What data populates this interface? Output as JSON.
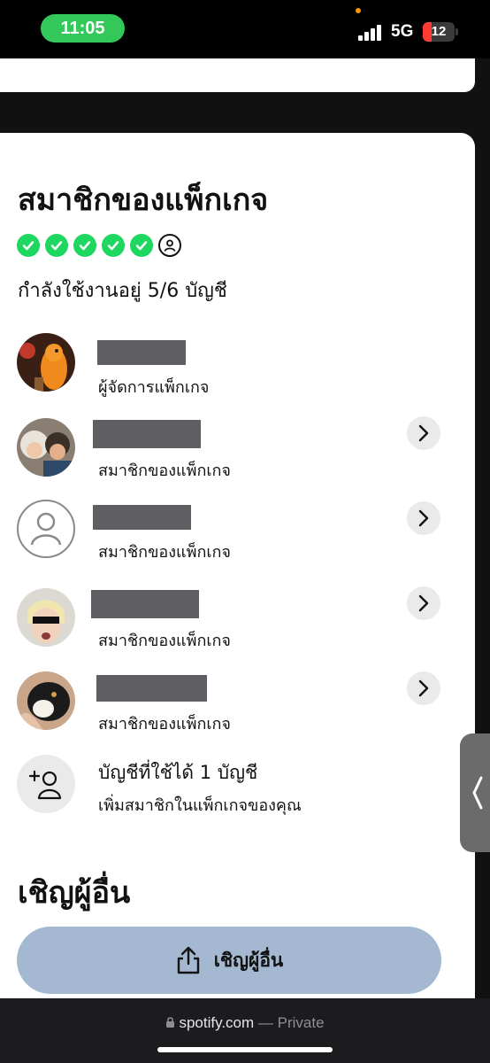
{
  "status_bar": {
    "time": "11:05",
    "network": "5G",
    "battery": "12"
  },
  "members_section": {
    "title": "สมาชิกของแพ็กเกจ",
    "usage": "กำลังใช้งานอยู่ 5/6 บัญชี",
    "members": [
      {
        "role": "ผู้จัดการแพ็กเกจ",
        "avatar": "orange-character-avatar",
        "has_chevron": false
      },
      {
        "role": "สมาชิกของแพ็กเกจ",
        "avatar": "anime-characters-avatar",
        "has_chevron": true
      },
      {
        "role": "สมาชิกของแพ็กเกจ",
        "avatar": "default-user-avatar",
        "has_chevron": true
      },
      {
        "role": "สมาชิกของแพ็กเกจ",
        "avatar": "sunglasses-meme-avatar",
        "has_chevron": true
      },
      {
        "role": "สมาชิกของแพ็กเกจ",
        "avatar": "cat-avatar",
        "has_chevron": true
      }
    ],
    "available": {
      "title": "บัญชีที่ใช้ได้ 1 บัญชี",
      "subtitle": "เพิ่มสมาชิกในแพ็กเกจของคุณ"
    }
  },
  "invite_section": {
    "title": "เชิญผู้อื่น",
    "button_label": "เชิญผู้อื่น"
  },
  "browser": {
    "domain": "spotify.com",
    "mode": "— Private"
  },
  "colors": {
    "accent_green": "#1ed760",
    "invite_button": "#a4b9d1",
    "redaction": "#5f5f63"
  }
}
